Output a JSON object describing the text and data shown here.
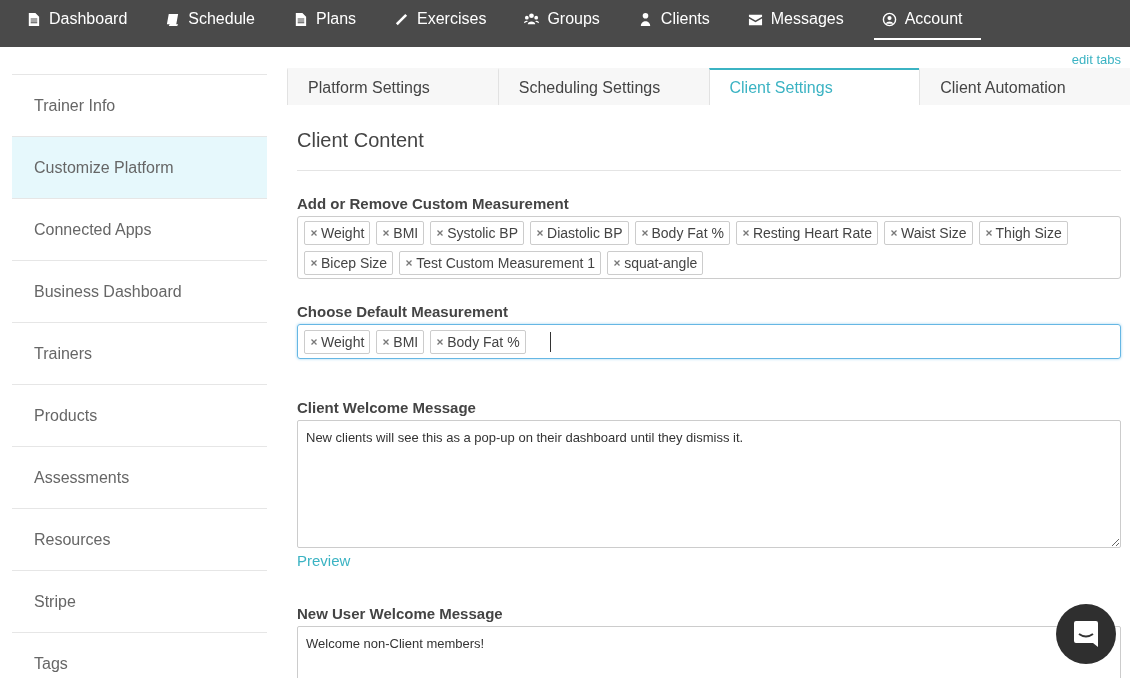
{
  "nav": [
    {
      "label": "Dashboard",
      "selected": false
    },
    {
      "label": "Schedule",
      "selected": false
    },
    {
      "label": "Plans",
      "selected": false
    },
    {
      "label": "Exercises",
      "selected": false
    },
    {
      "label": "Groups",
      "selected": false
    },
    {
      "label": "Clients",
      "selected": false
    },
    {
      "label": "Messages",
      "selected": false
    },
    {
      "label": "Account",
      "selected": true
    }
  ],
  "edit_tabs_link": "edit tabs",
  "sidebar": {
    "items": [
      {
        "label": "Trainer Info",
        "selected": false
      },
      {
        "label": "Customize Platform",
        "selected": true
      },
      {
        "label": "Connected Apps",
        "selected": false
      },
      {
        "label": "Business Dashboard",
        "selected": false
      },
      {
        "label": "Trainers",
        "selected": false
      },
      {
        "label": "Products",
        "selected": false
      },
      {
        "label": "Assessments",
        "selected": false
      },
      {
        "label": "Resources",
        "selected": false
      },
      {
        "label": "Stripe",
        "selected": false
      },
      {
        "label": "Tags",
        "selected": false
      }
    ]
  },
  "tabs": [
    {
      "label": "Platform Settings",
      "selected": false
    },
    {
      "label": "Scheduling Settings",
      "selected": false
    },
    {
      "label": "Client Settings",
      "selected": true
    },
    {
      "label": "Client Automation",
      "selected": false
    }
  ],
  "section_title": "Client Content",
  "custom_measurements": {
    "label": "Add or Remove Custom Measurement",
    "tags": [
      "Weight",
      "BMI",
      "Systolic BP",
      "Diastolic BP",
      "Body Fat %",
      "Resting Heart Rate",
      "Waist Size",
      "Thigh Size",
      "Bicep Size",
      "Test Custom Measurement 1",
      "squat-angle"
    ]
  },
  "default_measurements": {
    "label": "Choose Default Measurement",
    "focused": true,
    "tags": [
      "Weight",
      "BMI",
      "Body Fat %"
    ]
  },
  "welcome_message": {
    "label": "Client Welcome Message",
    "value": "New clients will see this as a pop-up on their dashboard until they dismiss it.",
    "link": "Preview"
  },
  "new_user_message": {
    "label": "New User Welcome Message",
    "value": "Welcome non-Client members!"
  }
}
